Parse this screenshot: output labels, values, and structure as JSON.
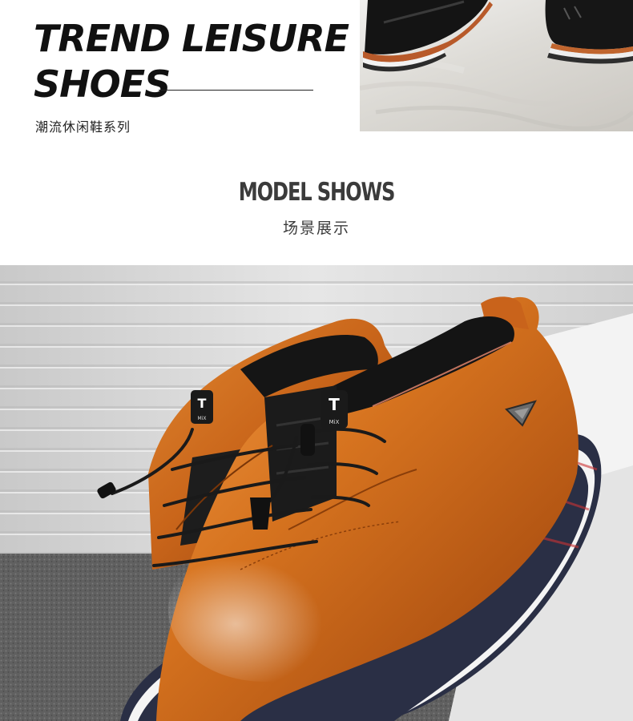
{
  "hero": {
    "title_line1": "TREND LEISURE",
    "title_line2": "SHOES",
    "subtitle": "潮流休闲鞋系列"
  },
  "section": {
    "title": "MODEL SHOWS",
    "subtitle": "场景展示"
  },
  "photos": {
    "top_image": "black-leather-shoes-photo",
    "main_image": "tan-leather-shoes-photo"
  },
  "shoe_badge": {
    "tag_letter": "T",
    "tag_text": "MiX"
  },
  "colors": {
    "heading_dark": "#111111",
    "section_grey": "#3b3b3b",
    "shoe_tan": "#d06f1c",
    "sole_navy": "#2a2f45"
  }
}
